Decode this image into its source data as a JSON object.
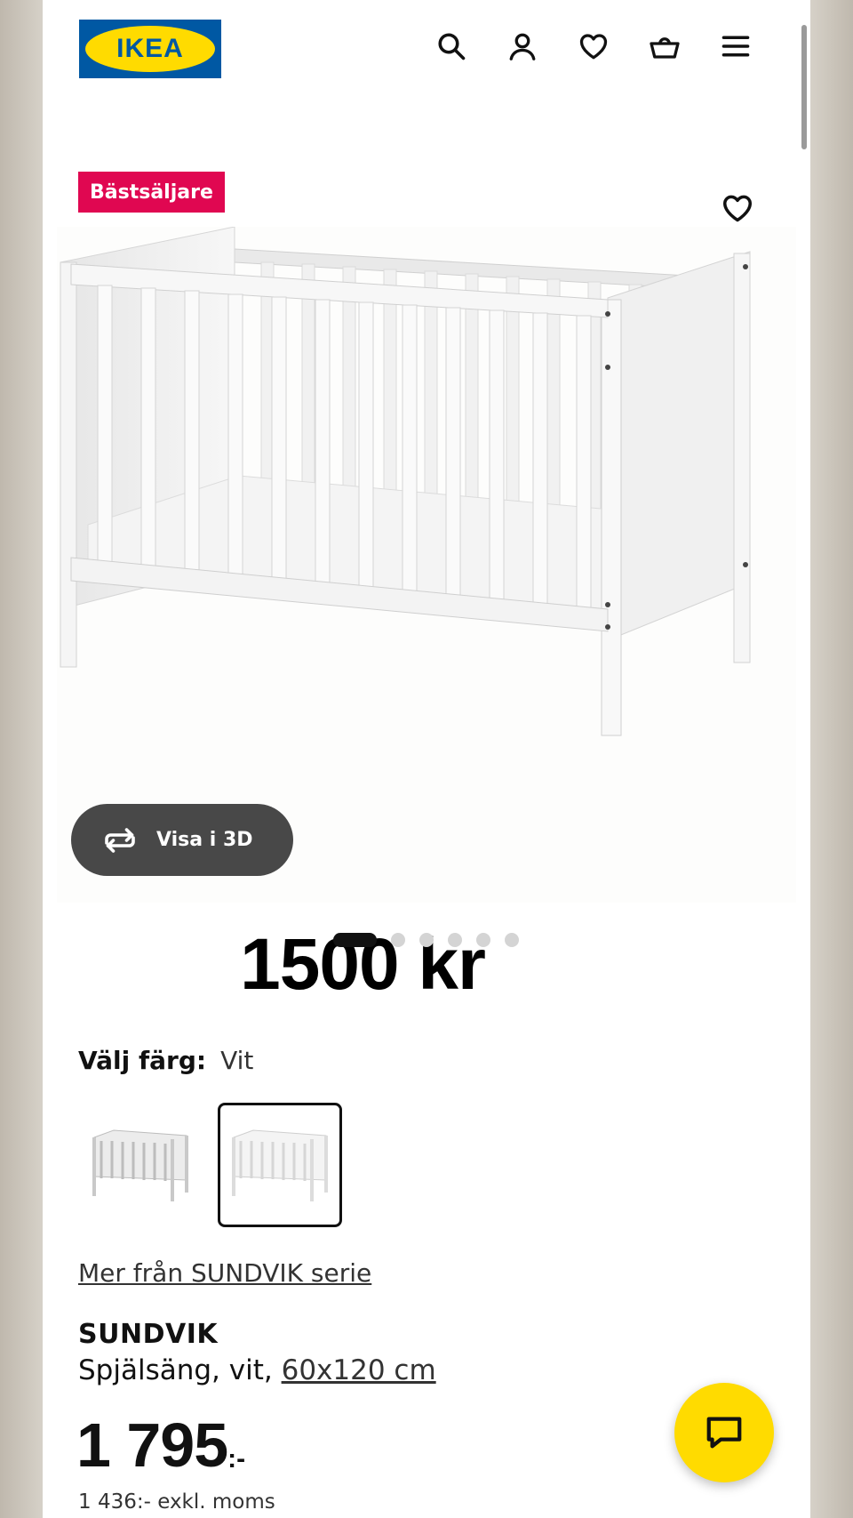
{
  "header": {
    "logo_text": "IKEA",
    "icons": [
      "search-icon",
      "account-icon",
      "favorites-icon",
      "basket-icon",
      "menu-icon"
    ]
  },
  "gallery": {
    "badge": "Bästsäljare",
    "overlay_price": "1500 kr",
    "view_3d_label": "Visa i 3D",
    "image_count": 6,
    "active_index": 0
  },
  "color_select": {
    "label": "Välj färg:",
    "value": "Vit",
    "selected_swatch": 1
  },
  "series_link": "Mer från SUNDVIK serie",
  "product": {
    "name": "SUNDVIK",
    "description": "Spjälsäng, vit,",
    "size": "60x120 cm",
    "price_integer": "1 795",
    "price_suffix": ":-",
    "price_excl_vat": "1 436:- exkl. moms"
  },
  "colors": {
    "brand_blue": "#0058a3",
    "brand_yellow": "#ffdb00",
    "badge_red": "#e00751"
  }
}
